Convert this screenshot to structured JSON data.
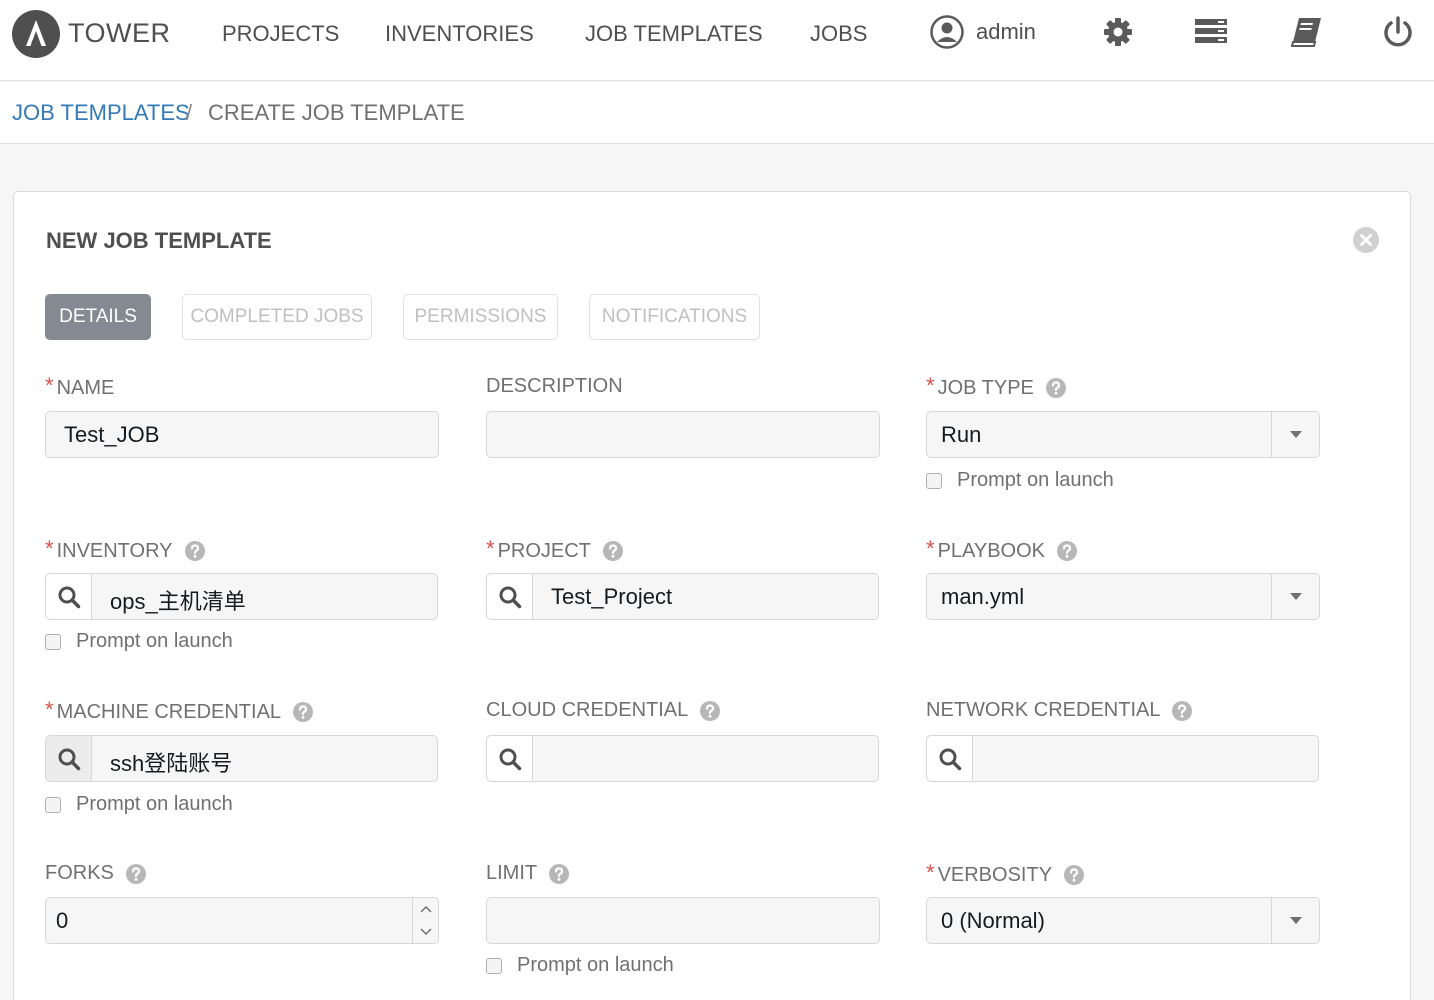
{
  "nav": {
    "brand": "TOWER",
    "links": [
      "PROJECTS",
      "INVENTORIES",
      "JOB TEMPLATES",
      "JOBS"
    ],
    "user": "admin",
    "icons": [
      "gear-icon",
      "server-list-icon",
      "book-icon",
      "power-icon"
    ]
  },
  "breadcrumb": {
    "parent": "JOB TEMPLATES",
    "separator": "/",
    "current": "CREATE JOB TEMPLATE"
  },
  "panel": {
    "title": "NEW JOB TEMPLATE",
    "tabs": [
      {
        "label": "DETAILS",
        "active": true
      },
      {
        "label": "COMPLETED JOBS",
        "active": false
      },
      {
        "label": "PERMISSIONS",
        "active": false
      },
      {
        "label": "NOTIFICATIONS",
        "active": false
      }
    ]
  },
  "form": {
    "name": {
      "label": "NAME",
      "required": true,
      "value": "Test_JOB"
    },
    "description": {
      "label": "DESCRIPTION",
      "required": false,
      "value": ""
    },
    "job_type": {
      "label": "JOB TYPE",
      "required": true,
      "value": "Run",
      "prompt": "Prompt on launch"
    },
    "inventory": {
      "label": "INVENTORY",
      "required": true,
      "value": "ops_主机清单",
      "prompt": "Prompt on launch"
    },
    "project": {
      "label": "PROJECT",
      "required": true,
      "value": "Test_Project"
    },
    "playbook": {
      "label": "PLAYBOOK",
      "required": true,
      "value": "man.yml"
    },
    "machine_credential": {
      "label": "MACHINE CREDENTIAL",
      "required": true,
      "value": "ssh登陆账号",
      "prompt": "Prompt on launch"
    },
    "cloud_credential": {
      "label": "CLOUD CREDENTIAL",
      "required": false,
      "value": ""
    },
    "network_credential": {
      "label": "NETWORK CREDENTIAL",
      "required": false,
      "value": ""
    },
    "forks": {
      "label": "FORKS",
      "required": false,
      "value": "0"
    },
    "limit": {
      "label": "LIMIT",
      "required": false,
      "value": "",
      "prompt": "Prompt on launch"
    },
    "verbosity": {
      "label": "VERBOSITY",
      "required": true,
      "value": "0 (Normal)"
    }
  },
  "required_marker": "*",
  "colors": {
    "link": "#337ab7",
    "required": "#d9534f",
    "active_tab": "#848992",
    "text": "#707070"
  }
}
